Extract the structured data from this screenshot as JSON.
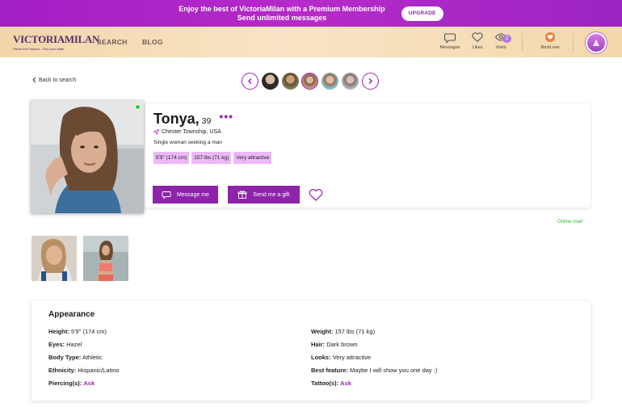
{
  "promo": {
    "line1": "Enjoy the best of VictoriaMilan with a Premium Membership",
    "line2": "Send unlimited messages",
    "upgrade_label": "UPGRADE"
  },
  "header": {
    "logo_text": "VICTORIAMILAN",
    "logo_tagline": "Relive the Passion - Find your Affair",
    "nav": {
      "search": "SEARCH",
      "blog": "BLOG"
    },
    "messages_label": "Messages",
    "likes_label": "Likes",
    "visits_label": "Visits",
    "visits_count": "2",
    "nextlove_label": "NextLove"
  },
  "back_label": "Back to search",
  "profile": {
    "name": "Tonya,",
    "age": "39",
    "more": "•••",
    "location": "Chester Township, USA",
    "seeking": "Single woman seeking a man",
    "tags": [
      "5'9\" (174 cm)",
      "157 lbs (71 kg)",
      "Very attractive"
    ],
    "message_label": "Message me",
    "gift_label": "Send me a gift",
    "online_status": "Online now!"
  },
  "appearance": {
    "title": "Appearance",
    "left": [
      {
        "label": "Height:",
        "value": "5'9\" (174 cm)"
      },
      {
        "label": "Eyes:",
        "value": "Hazel"
      },
      {
        "label": "Body Type:",
        "value": "Athletic"
      },
      {
        "label": "Ethnicity:",
        "value": "Hispanic/Latino"
      },
      {
        "label": "Piercing(s):",
        "value": "Ask"
      }
    ],
    "right": [
      {
        "label": "Weight:",
        "value": "157 lbs (71 kg)"
      },
      {
        "label": "Hair:",
        "value": "Dark brown"
      },
      {
        "label": "Looks:",
        "value": "Very attractive"
      },
      {
        "label": "Best feature:",
        "value": "Maybe I will show you one day :)"
      },
      {
        "label": "Tattoo(s):",
        "value": "Ask"
      }
    ]
  },
  "colors": {
    "brand_purple": "#8e24aa",
    "tag_pink": "#ecb8f5",
    "online_green": "#2ecc40"
  }
}
